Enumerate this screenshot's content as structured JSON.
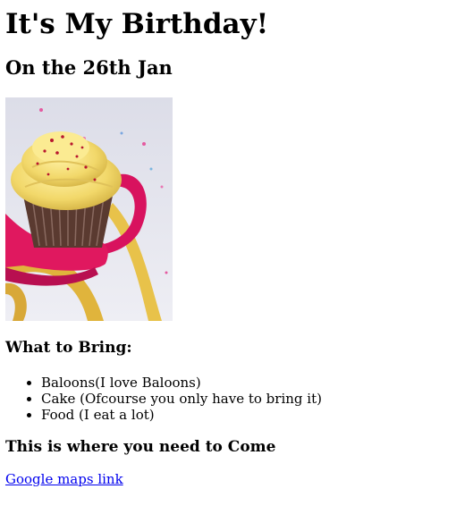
{
  "page": {
    "title": "It's My Birthday!",
    "date_heading": "On the 26th Jan"
  },
  "bring": {
    "heading": "What to Bring:",
    "items": [
      "Baloons(I love Baloons)",
      "Cake (Ofcourse you only have to bring it)",
      "Food (I eat a lot)"
    ]
  },
  "location": {
    "heading": "This is where you need to Come",
    "link_label": "Google maps link"
  },
  "colors": {
    "link": "#0000ee",
    "text": "#000000",
    "background": "#ffffff"
  },
  "icons": {
    "photo": "cupcake-with-ribbon"
  }
}
